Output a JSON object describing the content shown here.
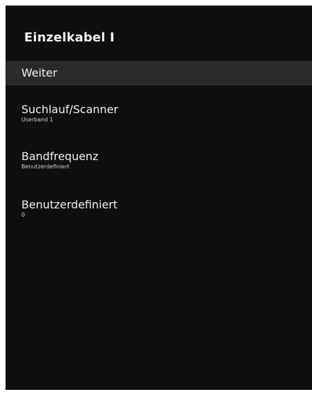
{
  "panel": {
    "title": "Einzelkabel I",
    "background": "#0f0f0f",
    "focused_background": "#2a2a2a"
  },
  "menu": {
    "items": [
      {
        "label": "Weiter",
        "value": ""
      },
      {
        "label": "Suchlauf/Scanner",
        "value": "Userband 1"
      },
      {
        "label": "Bandfrequenz",
        "value": "Benutzerdefiniert"
      },
      {
        "label": "Benutzerdefiniert",
        "value": "0"
      }
    ]
  }
}
